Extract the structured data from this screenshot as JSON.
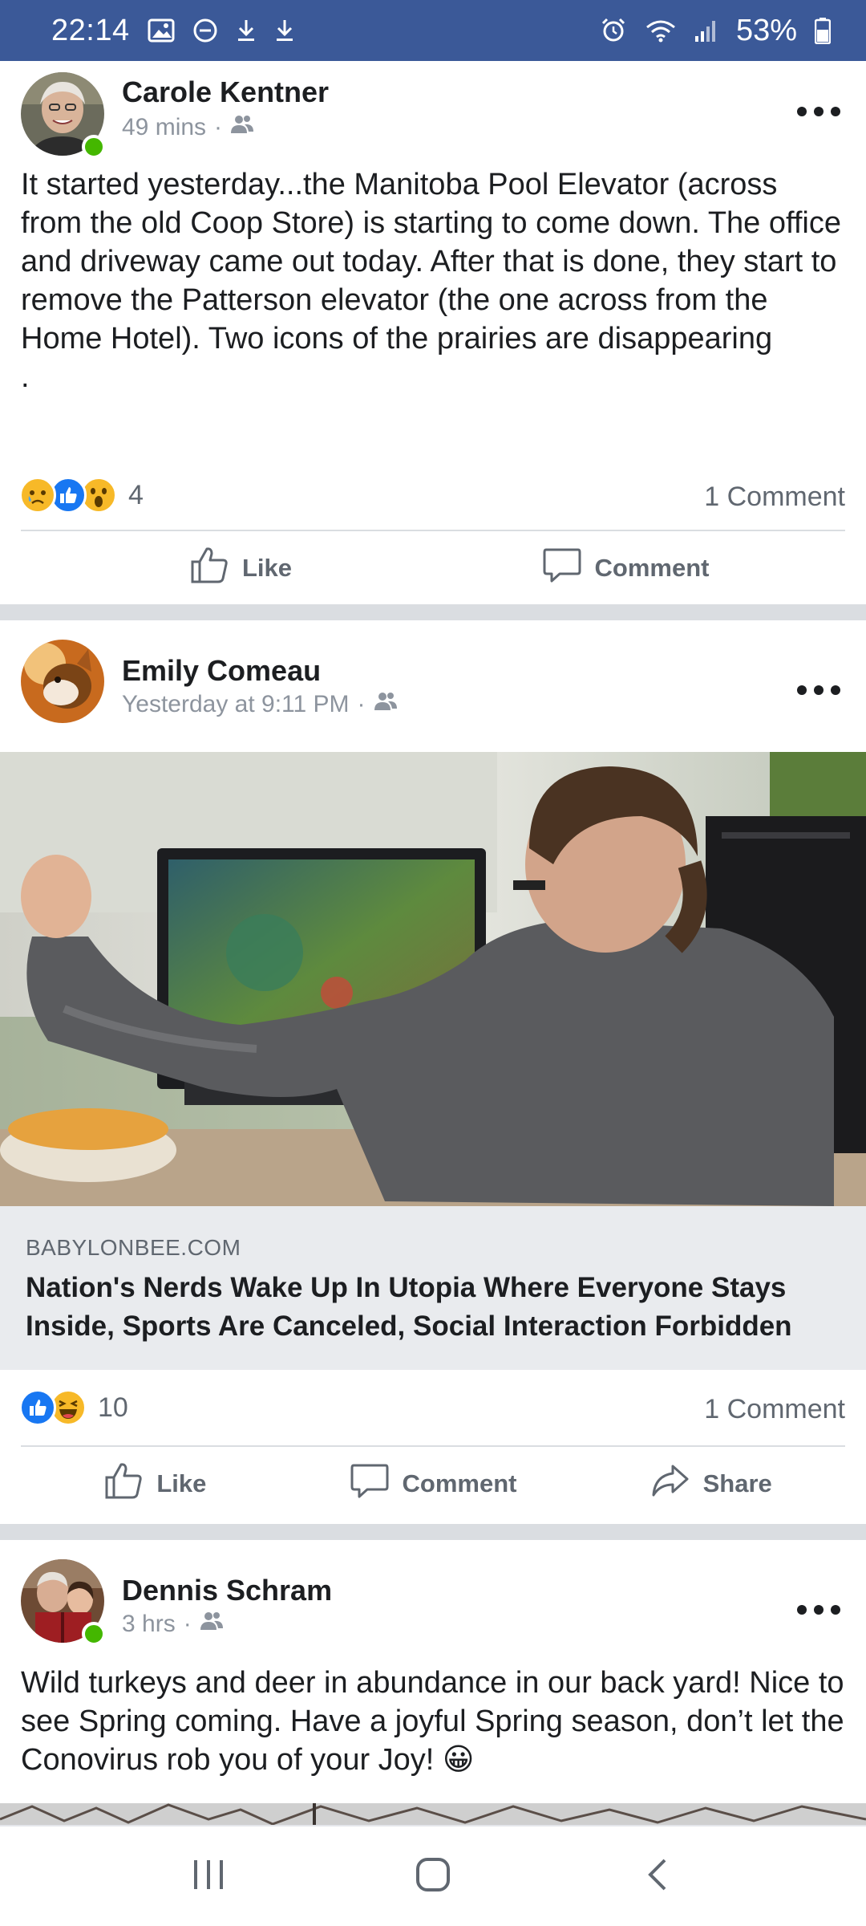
{
  "status_bar": {
    "time": "22:14",
    "battery_percent": "53%",
    "left_icons": [
      "gallery-icon",
      "do-not-disturb-icon",
      "download-icon",
      "download-icon"
    ],
    "right_icons": [
      "alarm-icon",
      "wifi-icon",
      "signal-icon",
      "battery-icon"
    ],
    "background": "#3b5998"
  },
  "posts": [
    {
      "author": "Carole Kentner",
      "time": "49 mins",
      "separator": "·",
      "audience_icon": "friends-icon",
      "online": true,
      "text": "It started yesterday...the Manitoba Pool Elevator (across from the old Coop Store) is starting to come down. The office and driveway came out today. After that is done, they start to remove the Patterson elevator (the one across from the Home Hotel). Two icons of the prairies are disappearing",
      "text_trailing": ".",
      "reactions": [
        "sad-icon",
        "like-icon",
        "wow-icon"
      ],
      "reaction_count": "4",
      "comment_count": "1 Comment",
      "actions": {
        "like": "Like",
        "comment": "Comment"
      }
    },
    {
      "author": "Emily Comeau",
      "time": "Yesterday at 9:11 PM",
      "separator": "·",
      "audience_icon": "friends-icon",
      "online": false,
      "link": {
        "domain": "BABYLONBEE.COM",
        "title": "Nation's Nerds Wake Up In Utopia Where Everyone Stays Inside, Sports Are Canceled, Social Interaction Forbidden"
      },
      "reactions": [
        "like-icon",
        "haha-icon"
      ],
      "reaction_count": "10",
      "comment_count": "1 Comment",
      "actions": {
        "like": "Like",
        "comment": "Comment",
        "share": "Share"
      }
    },
    {
      "author": "Dennis Schram",
      "time": "3 hrs",
      "separator": "·",
      "audience_icon": "friends-icon",
      "online": true,
      "text": "Wild turkeys and deer in abundance in our back yard! Nice to see Spring coming. Have a joyful Spring season, don’t let the Conovirus rob you of your Joy!",
      "text_emoji": "😀"
    }
  ],
  "nav_bar": {
    "buttons": [
      "recent-apps-icon",
      "home-icon",
      "back-icon"
    ]
  },
  "colors": {
    "facebook_blue": "#3b5998",
    "like_blue": "#1877f2",
    "reaction_yellow": "#f7b928",
    "online_green": "#44b700",
    "secondary_text": "#606770",
    "divider": "#dadde1"
  }
}
